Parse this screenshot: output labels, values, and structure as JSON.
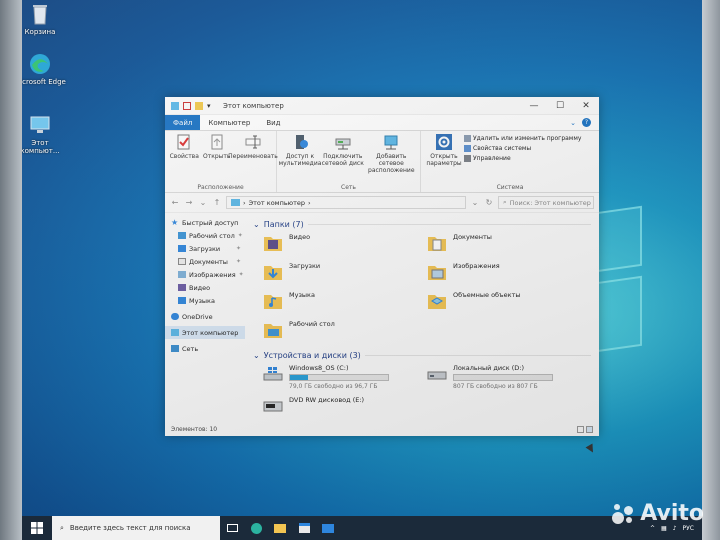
{
  "desktop": {
    "icons": [
      {
        "label": "Корзина",
        "icon": "recycle-bin-icon"
      },
      {
        "label": "Microsoft Edge",
        "icon": "edge-icon"
      },
      {
        "label": "Этот компьют...",
        "icon": "this-pc-icon"
      }
    ]
  },
  "window": {
    "title": "Этот компьютер",
    "controls": {
      "minimize": "—",
      "maximize": "☐",
      "close": "✕"
    },
    "tabs": [
      {
        "label": "Файл",
        "active": true
      },
      {
        "label": "Компьютер",
        "active": false
      },
      {
        "label": "Вид",
        "active": false
      }
    ],
    "ribbon": {
      "groups": [
        {
          "label": "Расположение",
          "buttons": [
            "Свойства",
            "Открыть",
            "Переименовать"
          ]
        },
        {
          "label": "Сеть",
          "buttons": [
            "Доступ к мультимедиа",
            "Подключить сетевой диск",
            "Добавить сетевое расположение"
          ]
        },
        {
          "label": "Система",
          "buttons": [
            "Открыть параметры"
          ],
          "small": [
            "Удалить или изменить программу",
            "Свойства системы",
            "Управление"
          ]
        }
      ]
    },
    "address": {
      "path_root": "Этот компьютер",
      "search_placeholder": "Поиск: Этот компьютер"
    },
    "nav": [
      {
        "label": "Быстрый доступ",
        "level": 0,
        "pinned": false,
        "selected": false
      },
      {
        "label": "Рабочий стол",
        "level": 1,
        "pinned": true,
        "selected": false
      },
      {
        "label": "Загрузки",
        "level": 1,
        "pinned": true,
        "selected": false
      },
      {
        "label": "Документы",
        "level": 1,
        "pinned": true,
        "selected": false
      },
      {
        "label": "Изображения",
        "level": 1,
        "pinned": true,
        "selected": false
      },
      {
        "label": "Видео",
        "level": 1,
        "pinned": false,
        "selected": false
      },
      {
        "label": "Музыка",
        "level": 1,
        "pinned": false,
        "selected": false
      },
      {
        "label": "OneDrive",
        "level": 0,
        "pinned": false,
        "selected": false
      },
      {
        "label": "Этот компьютер",
        "level": 0,
        "pinned": false,
        "selected": true
      },
      {
        "label": "Сеть",
        "level": 0,
        "pinned": false,
        "selected": false
      }
    ],
    "folders_header": "Папки (7)",
    "folders": [
      {
        "label": "Видео",
        "icon": "video-folder-icon"
      },
      {
        "label": "Документы",
        "icon": "documents-folder-icon"
      },
      {
        "label": "Загрузки",
        "icon": "downloads-folder-icon"
      },
      {
        "label": "Изображения",
        "icon": "pictures-folder-icon"
      },
      {
        "label": "Музыка",
        "icon": "music-folder-icon"
      },
      {
        "label": "Объемные объекты",
        "icon": "3d-objects-folder-icon"
      },
      {
        "label": "Рабочий стол",
        "icon": "desktop-folder-icon"
      }
    ],
    "drives_header": "Устройства и диски (3)",
    "drives": [
      {
        "label": "Windows8_OS (C:)",
        "free": "79,0 ГБ свободно из 96,7 ГБ",
        "used_fraction": 0.18,
        "icon": "windows-drive-icon"
      },
      {
        "label": "Локальный диск (D:)",
        "free": "807 ГБ свободно из 807 ГБ",
        "used_fraction": 0.0,
        "icon": "hard-drive-icon"
      },
      {
        "label": "DVD RW дисковод (E:)",
        "free": "",
        "used_fraction": null,
        "icon": "dvd-drive-icon"
      }
    ],
    "status": "Элементов: 10"
  },
  "taskbar": {
    "search_placeholder": "Введите здесь текст для поиска",
    "apps": [
      "task-view-icon",
      "edge-icon",
      "file-explorer-icon",
      "store-icon",
      "mail-icon"
    ],
    "tray_lang": "РУС"
  },
  "watermark": "Avito",
  "colors": {
    "accent": "#1a73c5",
    "selection": "#d9e8f7",
    "drive_bar": "#26a0da"
  }
}
